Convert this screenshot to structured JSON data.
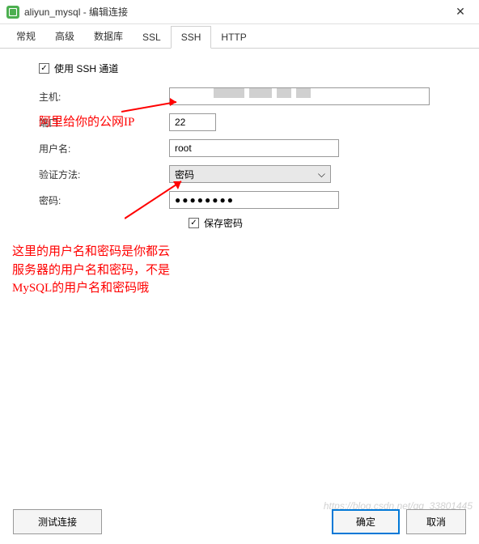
{
  "titlebar": {
    "title": "aliyun_mysql - 编辑连接"
  },
  "tabs": {
    "items": [
      {
        "label": "常规"
      },
      {
        "label": "高级"
      },
      {
        "label": "数据库"
      },
      {
        "label": "SSL"
      },
      {
        "label": "SSH"
      },
      {
        "label": "HTTP"
      }
    ]
  },
  "form": {
    "use_ssh_label": "使用 SSH 通道",
    "host_label": "主机:",
    "host_value": "",
    "port_label": "端口:",
    "port_value": "22",
    "user_label": "用户名:",
    "user_value": "root",
    "auth_label": "验证方法:",
    "auth_value": "密码",
    "pwd_label": "密码:",
    "pwd_value": "●●●●●●●●",
    "save_pwd_label": "保存密码"
  },
  "annotations": {
    "note1": "阿里给你的公网IP",
    "note2": "这里的用户名和密码是你都云服务器的用户名和密码，不是MySQL的用户名和密码哦"
  },
  "footer": {
    "test_label": "测试连接",
    "ok_label": "确定",
    "cancel_label": "取消"
  },
  "watermark": "https://blog.csdn.net/qq_33801445"
}
